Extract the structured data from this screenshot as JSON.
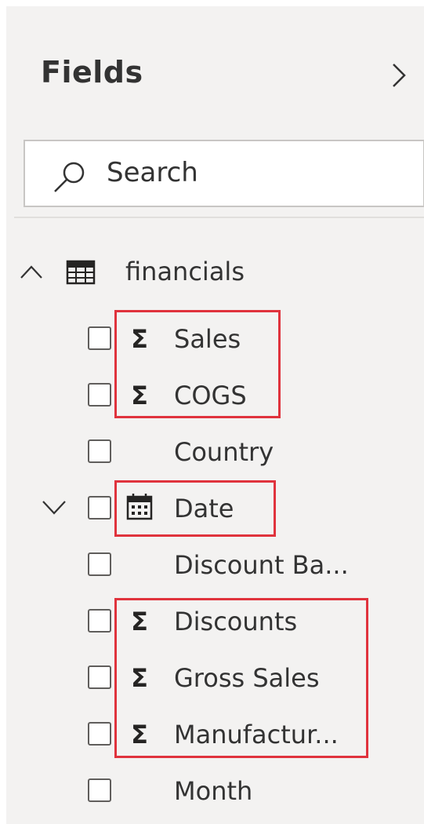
{
  "pane": {
    "title": "Fields",
    "collapse_icon": "chevron-right-icon"
  },
  "search": {
    "placeholder": "Search",
    "icon": "search-icon"
  },
  "table": {
    "name": "financials",
    "expanded": true,
    "icon": "table-icon"
  },
  "fields": [
    {
      "name": "Sales",
      "type": "sigma",
      "icon": "sigma-icon",
      "highlighted": true
    },
    {
      "name": "COGS",
      "type": "sigma",
      "icon": "sigma-icon",
      "highlighted": true
    },
    {
      "name": "Country",
      "type": "text",
      "icon": "",
      "highlighted": false
    },
    {
      "name": "Date",
      "type": "date",
      "icon": "calendar-icon",
      "highlighted": true,
      "expandable": true
    },
    {
      "name": "Discount Ba...",
      "type": "text",
      "icon": "",
      "highlighted": false
    },
    {
      "name": "Discounts",
      "type": "sigma",
      "icon": "sigma-icon",
      "highlighted": true
    },
    {
      "name": "Gross Sales",
      "type": "sigma",
      "icon": "sigma-icon",
      "highlighted": true
    },
    {
      "name": "Manufactur...",
      "type": "sigma",
      "icon": "sigma-icon",
      "highlighted": true
    },
    {
      "name": "Month",
      "type": "text",
      "icon": "",
      "highlighted": false
    }
  ],
  "sigma_glyph": "Σ",
  "colors": {
    "pane_background": "#f3f2f1",
    "highlight": "#e0333d",
    "text": "#333333"
  }
}
